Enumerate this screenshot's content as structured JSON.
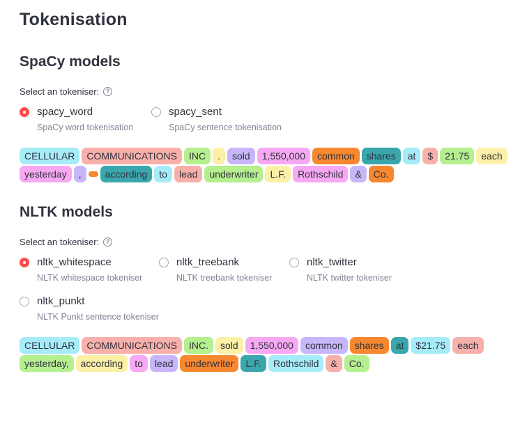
{
  "page_title": "Tokenisation",
  "sections": [
    {
      "heading": "SpaCy models",
      "select_label": "Select an tokeniser:",
      "help_icon": "?",
      "options": [
        {
          "name": "spacy_word",
          "description": "SpaCy word tokenisation",
          "checked": true
        },
        {
          "name": "spacy_sent",
          "description": "SpaCy sentence tokenisation",
          "checked": false
        }
      ],
      "token_lines": [
        [
          {
            "text": "CELLULAR",
            "color": "cyan"
          },
          {
            "text": "COMMUNICATIONS",
            "color": "salmon"
          },
          {
            "text": "INC",
            "color": "lime"
          },
          {
            "text": ".",
            "color": "yellow"
          },
          {
            "text": "sold",
            "color": "purple"
          },
          {
            "text": "1,550,000",
            "color": "pink"
          },
          {
            "text": "common",
            "color": "orange"
          },
          {
            "text": "shares",
            "color": "teal"
          },
          {
            "text": "at",
            "color": "cyan"
          },
          {
            "text": "$",
            "color": "salmon"
          },
          {
            "text": "21.75",
            "color": "lime"
          },
          {
            "text": "each",
            "color": "yellow"
          }
        ],
        [
          {
            "text": "yesterday",
            "color": "pink"
          },
          {
            "text": ",",
            "color": "purple"
          },
          {
            "text": " ",
            "color": "orange",
            "whitespace": true
          },
          {
            "text": "according",
            "color": "teal"
          },
          {
            "text": "to",
            "color": "cyan"
          },
          {
            "text": "lead",
            "color": "salmon"
          },
          {
            "text": "underwriter",
            "color": "lime"
          },
          {
            "text": "L.F.",
            "color": "yellow"
          },
          {
            "text": "Rothschild",
            "color": "pink"
          },
          {
            "text": "&",
            "color": "purple"
          },
          {
            "text": "Co.",
            "color": "orange"
          }
        ]
      ]
    },
    {
      "heading": "NLTK models",
      "select_label": "Select an tokeniser:",
      "help_icon": "?",
      "options": [
        {
          "name": "nltk_whitespace",
          "description": "NLTK whitespace tokeniser",
          "checked": true
        },
        {
          "name": "nltk_treebank",
          "description": "NLTK treebank tokeniser",
          "checked": false
        },
        {
          "name": "nltk_twitter",
          "description": "NLTK twitter tokeniser",
          "checked": false
        },
        {
          "name": "nltk_punkt",
          "description": "NLTK Punkt sentence tokeniser",
          "checked": false
        }
      ],
      "token_lines": [
        [
          {
            "text": "CELLULAR",
            "color": "cyan"
          },
          {
            "text": "COMMUNICATIONS",
            "color": "salmon"
          },
          {
            "text": "INC.",
            "color": "lime"
          },
          {
            "text": "sold",
            "color": "yellow"
          },
          {
            "text": "1,550,000",
            "color": "pink"
          },
          {
            "text": "common",
            "color": "purple"
          },
          {
            "text": "shares",
            "color": "orange"
          },
          {
            "text": "at",
            "color": "teal"
          },
          {
            "text": "$21.75",
            "color": "cyan"
          },
          {
            "text": "each",
            "color": "salmon"
          }
        ],
        [
          {
            "text": "yesterday,",
            "color": "lime"
          },
          {
            "text": "according",
            "color": "yellow"
          },
          {
            "text": "to",
            "color": "pink"
          },
          {
            "text": "lead",
            "color": "purple"
          },
          {
            "text": "underwriter",
            "color": "orange"
          },
          {
            "text": "L.F.",
            "color": "teal"
          },
          {
            "text": "Rothschild",
            "color": "cyan"
          },
          {
            "text": "&",
            "color": "salmon"
          },
          {
            "text": "Co.",
            "color": "lime"
          }
        ]
      ]
    }
  ]
}
